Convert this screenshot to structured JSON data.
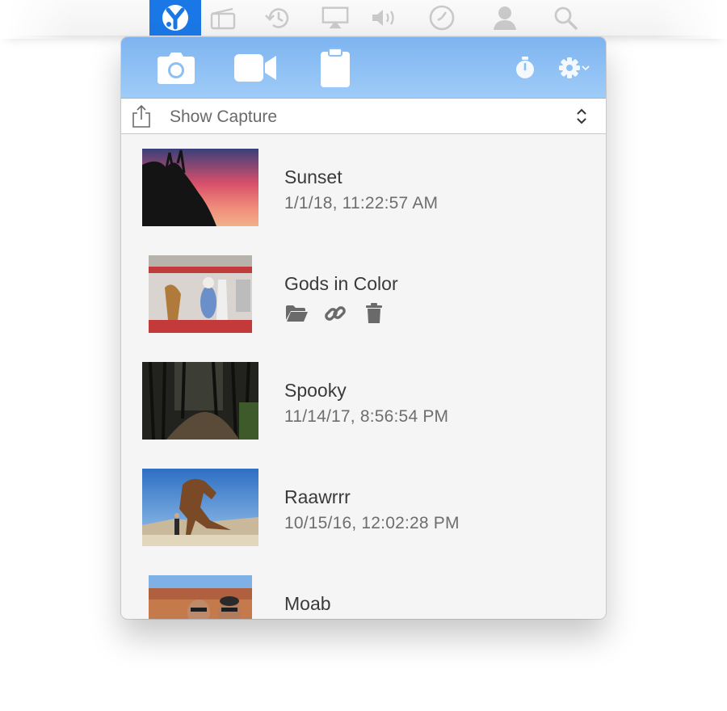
{
  "menubar": {
    "icons": [
      "yoink-app-icon",
      "clapper-icon",
      "time-machine-icon",
      "airplay-icon",
      "volume-icon",
      "clock-icon",
      "user-icon",
      "spotlight-search-icon"
    ],
    "active_color": "#1a78e6"
  },
  "toolbar": {
    "buttons": [
      "camera-icon",
      "video-camera-icon",
      "clipboard-icon",
      "timer-icon",
      "gear-icon"
    ],
    "bg_color": "#8cc0f4"
  },
  "filter": {
    "label": "Show Capture"
  },
  "captures": [
    {
      "title": "Sunset",
      "date": "1/1/18, 11:22:57 AM"
    },
    {
      "title": "Gods in Color",
      "date": "",
      "actions": [
        "folder-icon",
        "link-icon",
        "trash-icon"
      ]
    },
    {
      "title": "Spooky",
      "date": "11/14/17, 8:56:54 PM"
    },
    {
      "title": "Raawrrr",
      "date": "10/15/16, 12:02:28 PM"
    },
    {
      "title": "Moab",
      "date": ""
    }
  ]
}
